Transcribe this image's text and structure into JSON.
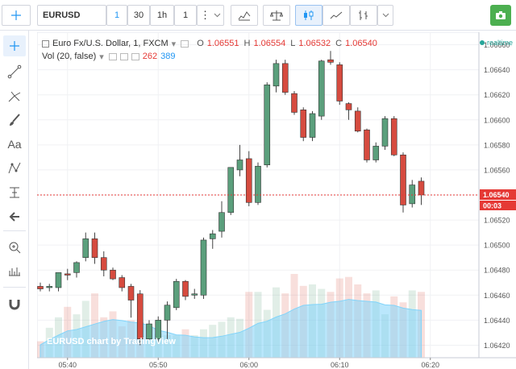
{
  "toolbar": {
    "symbol": "EURUSD",
    "intervals": [
      "1",
      "30",
      "1h",
      "1"
    ],
    "more": "⋮"
  },
  "legend": {
    "title": "Euro Fx/U.S. Dollar, 1, FXCM",
    "o_label": "O",
    "o": "1.06551",
    "h_label": "H",
    "h": "1.06554",
    "l_label": "L",
    "l": "1.06532",
    "c_label": "C",
    "c": "1.06540",
    "vol_label": "Vol (20, false)",
    "vol_red": "262",
    "vol_blue": "389"
  },
  "status": {
    "realtime": "realtime"
  },
  "attribution": "EURUSD chart by TradingView",
  "colors": {
    "up": "#5b9f7c",
    "down": "#d64b3f",
    "last_price": "#e53935",
    "volume_area": "#81d4fa"
  },
  "chart_data": {
    "type": "candlestick",
    "x_labels": [
      "05:40",
      "05:50",
      "06:00",
      "06:10",
      "06:20"
    ],
    "y_ticks": [
      1.0642,
      1.0644,
      1.0646,
      1.0648,
      1.065,
      1.0652,
      1.0654,
      1.0656,
      1.0658,
      1.066,
      1.0662,
      1.0664,
      1.0666
    ],
    "ylim": [
      1.0641,
      1.0667
    ],
    "last_price": "1.06540",
    "countdown": "00:03",
    "candles": [
      {
        "o": 1.06467,
        "h": 1.0647,
        "l": 1.06463,
        "c": 1.06465
      },
      {
        "o": 1.06466,
        "h": 1.06469,
        "l": 1.06463,
        "c": 1.06467
      },
      {
        "o": 1.06466,
        "h": 1.06478,
        "l": 1.06463,
        "c": 1.06478
      },
      {
        "o": 1.06477,
        "h": 1.06481,
        "l": 1.06472,
        "c": 1.06476
      },
      {
        "o": 1.06478,
        "h": 1.06487,
        "l": 1.06474,
        "c": 1.06486
      },
      {
        "o": 1.0649,
        "h": 1.0651,
        "l": 1.06487,
        "c": 1.06505
      },
      {
        "o": 1.06505,
        "h": 1.0651,
        "l": 1.06485,
        "c": 1.0649
      },
      {
        "o": 1.0649,
        "h": 1.06495,
        "l": 1.06475,
        "c": 1.0648
      },
      {
        "o": 1.0648,
        "h": 1.06482,
        "l": 1.06472,
        "c": 1.06473
      },
      {
        "o": 1.06474,
        "h": 1.06476,
        "l": 1.06463,
        "c": 1.06466
      },
      {
        "o": 1.06467,
        "h": 1.06469,
        "l": 1.06442,
        "c": 1.06456
      },
      {
        "o": 1.06461,
        "h": 1.06464,
        "l": 1.0642,
        "c": 1.06425
      },
      {
        "o": 1.06425,
        "h": 1.0644,
        "l": 1.06421,
        "c": 1.06437
      },
      {
        "o": 1.06425,
        "h": 1.06443,
        "l": 1.06422,
        "c": 1.0644
      },
      {
        "o": 1.0644,
        "h": 1.06455,
        "l": 1.06425,
        "c": 1.06452
      },
      {
        "o": 1.0645,
        "h": 1.06473,
        "l": 1.06448,
        "c": 1.06471
      },
      {
        "o": 1.06471,
        "h": 1.06472,
        "l": 1.06456,
        "c": 1.06459
      },
      {
        "o": 1.0646,
        "h": 1.06465,
        "l": 1.06457,
        "c": 1.06461
      },
      {
        "o": 1.0646,
        "h": 1.06506,
        "l": 1.06457,
        "c": 1.06504
      },
      {
        "o": 1.06505,
        "h": 1.06512,
        "l": 1.06497,
        "c": 1.06509
      },
      {
        "o": 1.06511,
        "h": 1.06535,
        "l": 1.06506,
        "c": 1.06526
      },
      {
        "o": 1.06526,
        "h": 1.0656,
        "l": 1.06524,
        "c": 1.06562
      },
      {
        "o": 1.0656,
        "h": 1.0658,
        "l": 1.06555,
        "c": 1.06568
      },
      {
        "o": 1.06569,
        "h": 1.06575,
        "l": 1.06531,
        "c": 1.06534
      },
      {
        "o": 1.06534,
        "h": 1.06566,
        "l": 1.06532,
        "c": 1.06563
      },
      {
        "o": 1.06564,
        "h": 1.0663,
        "l": 1.06562,
        "c": 1.06628
      },
      {
        "o": 1.06627,
        "h": 1.06648,
        "l": 1.06622,
        "c": 1.06645
      },
      {
        "o": 1.06645,
        "h": 1.06648,
        "l": 1.0662,
        "c": 1.06622
      },
      {
        "o": 1.06621,
        "h": 1.06623,
        "l": 1.06604,
        "c": 1.06606
      },
      {
        "o": 1.06608,
        "h": 1.0661,
        "l": 1.06583,
        "c": 1.06586
      },
      {
        "o": 1.06586,
        "h": 1.06607,
        "l": 1.06583,
        "c": 1.06605
      },
      {
        "o": 1.06603,
        "h": 1.06648,
        "l": 1.066,
        "c": 1.06647
      },
      {
        "o": 1.06648,
        "h": 1.06655,
        "l": 1.06644,
        "c": 1.06646
      },
      {
        "o": 1.06644,
        "h": 1.06646,
        "l": 1.06612,
        "c": 1.06615
      },
      {
        "o": 1.06613,
        "h": 1.06614,
        "l": 1.066,
        "c": 1.06608
      },
      {
        "o": 1.06607,
        "h": 1.0661,
        "l": 1.0659,
        "c": 1.06591
      },
      {
        "o": 1.06592,
        "h": 1.06593,
        "l": 1.06566,
        "c": 1.06568
      },
      {
        "o": 1.06568,
        "h": 1.06582,
        "l": 1.06566,
        "c": 1.06579
      },
      {
        "o": 1.06579,
        "h": 1.06603,
        "l": 1.06576,
        "c": 1.06601
      },
      {
        "o": 1.06601,
        "h": 1.06603,
        "l": 1.06571,
        "c": 1.06572
      },
      {
        "o": 1.06572,
        "h": 1.06574,
        "l": 1.06526,
        "c": 1.06532
      },
      {
        "o": 1.06533,
        "h": 1.06552,
        "l": 1.0653,
        "c": 1.06548
      },
      {
        "o": 1.06551,
        "h": 1.06554,
        "l": 1.06532,
        "c": 1.0654
      }
    ],
    "volume": [
      11,
      20,
      27,
      34,
      29,
      38,
      43,
      27,
      31,
      21,
      25,
      24,
      21,
      16,
      15,
      15,
      19,
      15,
      19,
      22,
      24,
      27,
      26,
      44,
      44,
      32,
      47,
      43,
      56,
      48,
      49,
      46,
      44,
      53,
      54,
      49,
      43,
      45,
      29,
      41,
      37,
      45,
      44
    ]
  }
}
